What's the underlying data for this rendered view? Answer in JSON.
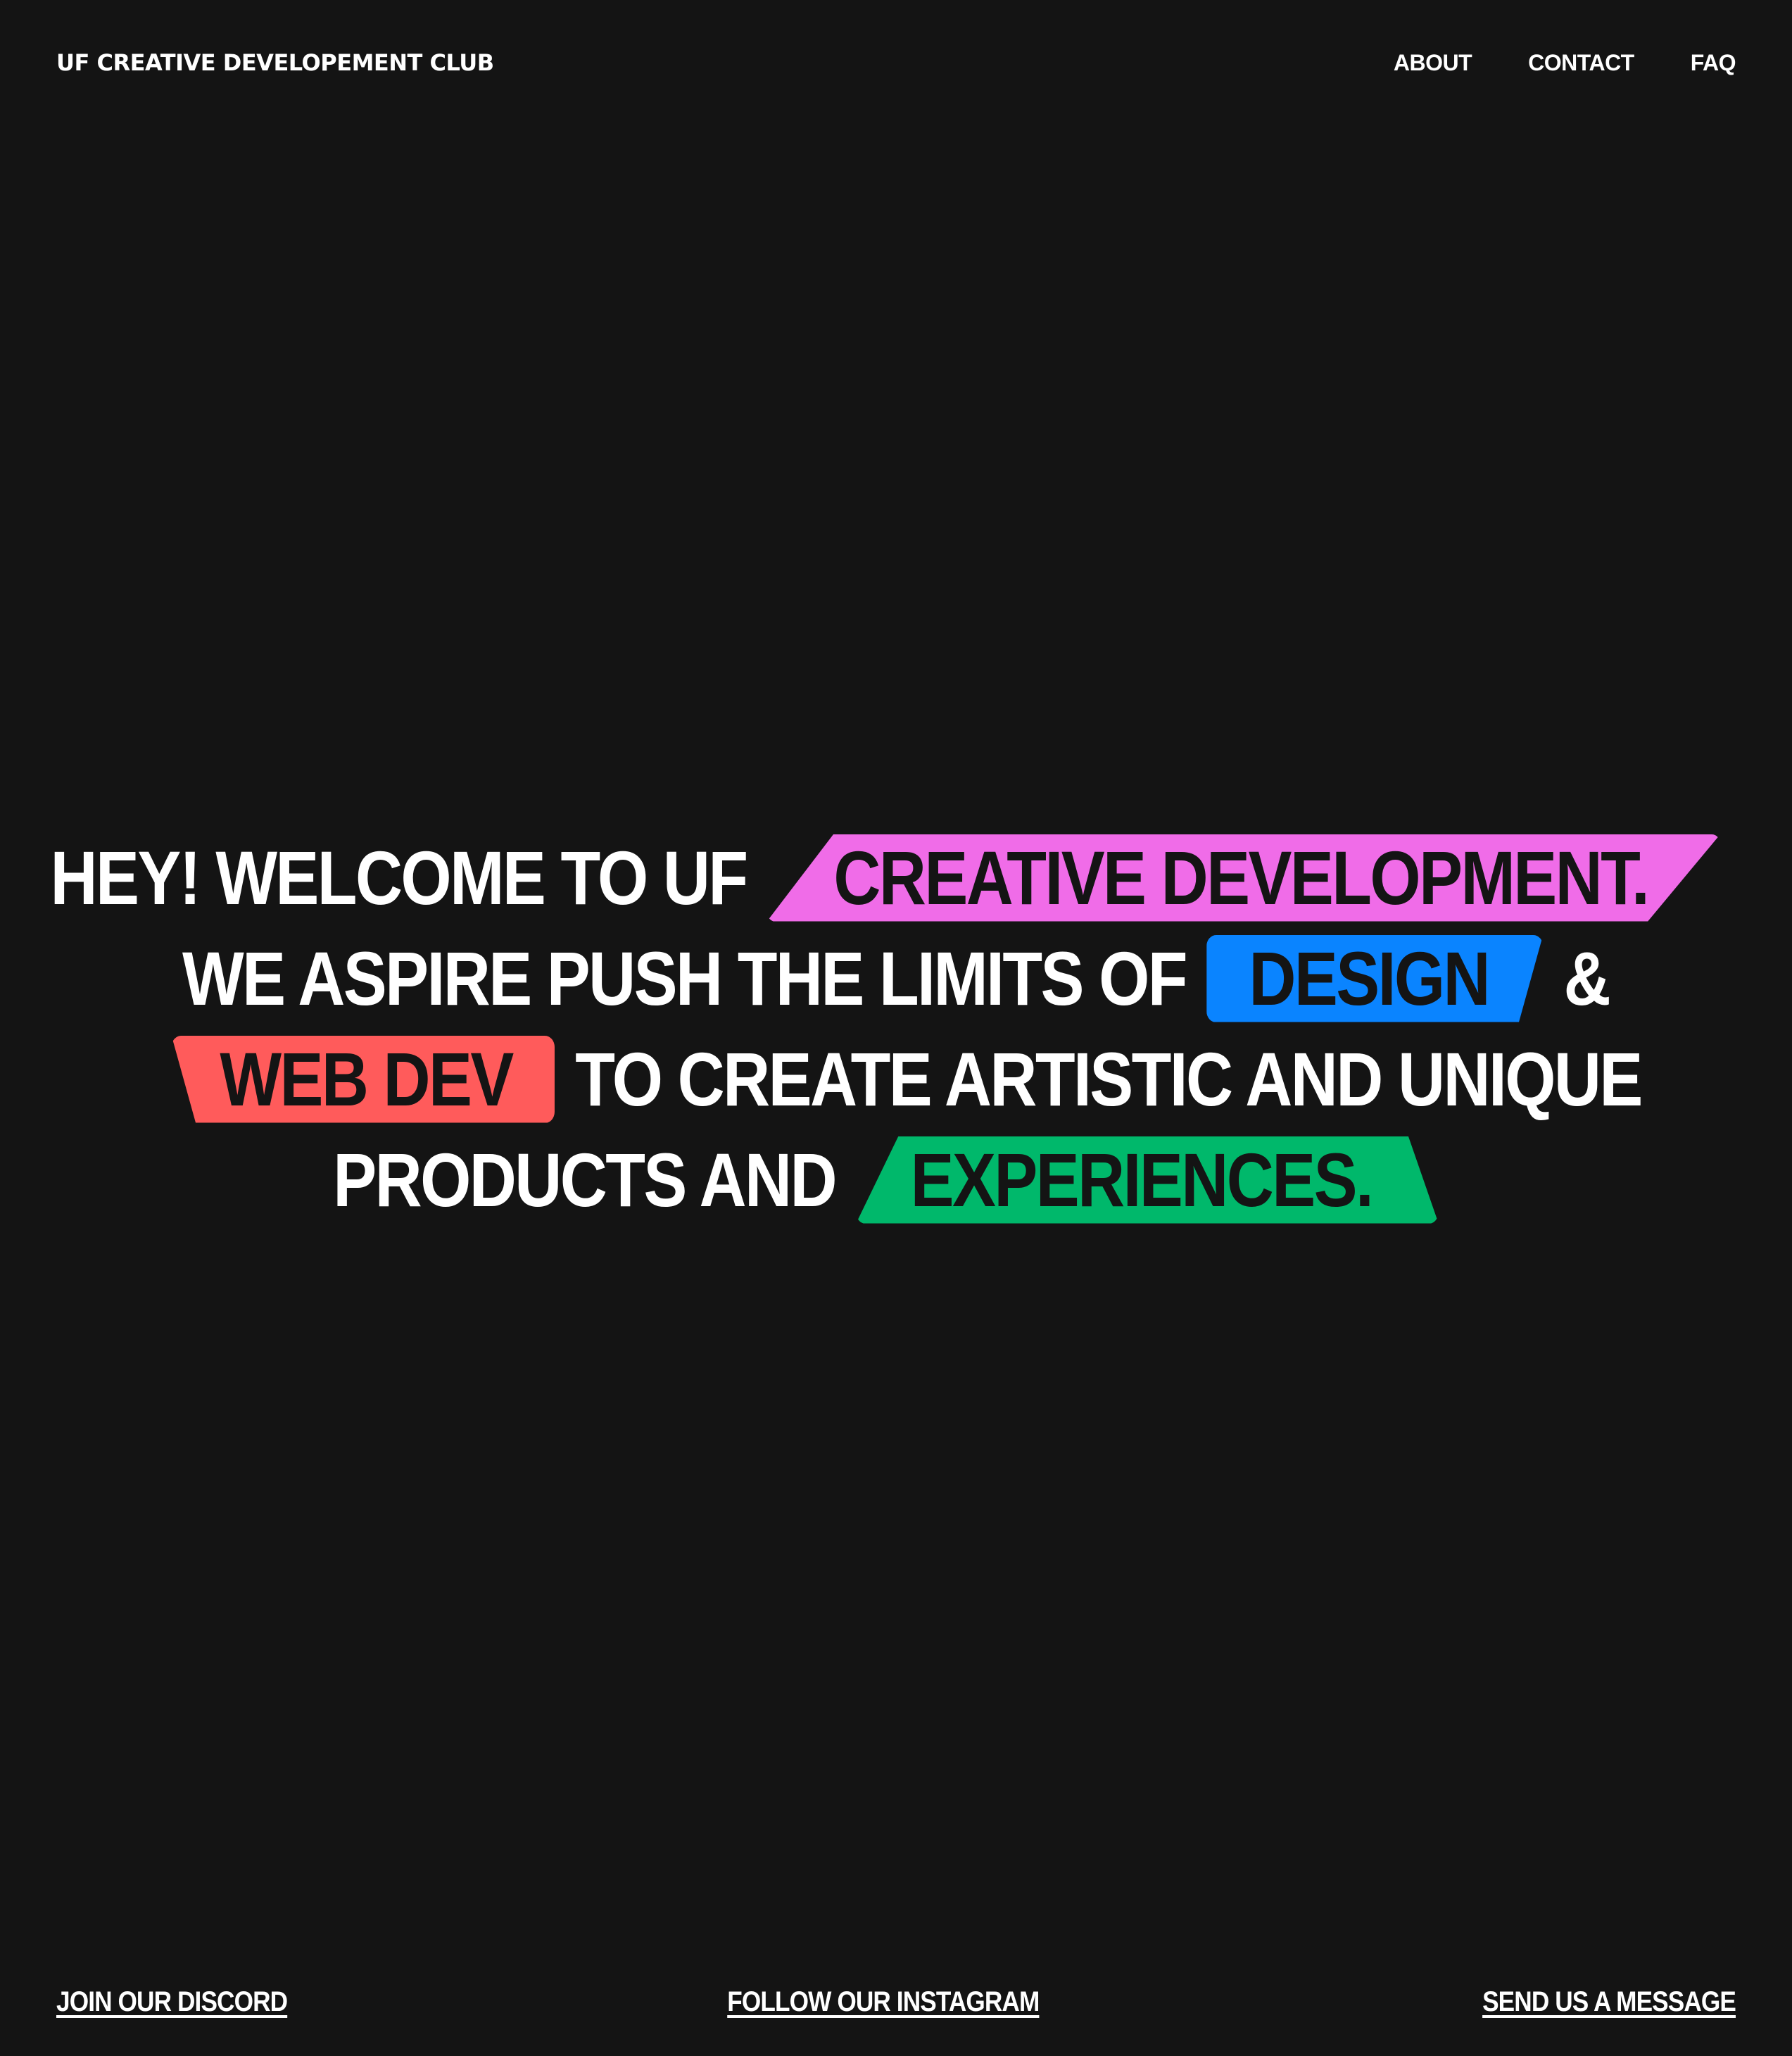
{
  "header": {
    "logo": "UF CREATIVE DEVELOPEMENT CLUB",
    "nav": [
      {
        "label": "ABOUT"
      },
      {
        "label": "CONTACT"
      },
      {
        "label": "FAQ"
      }
    ]
  },
  "hero": {
    "line1": {
      "text": "HEY! WELCOME TO UF",
      "tag": "CREATIVE DEVELOPMENT."
    },
    "line2": {
      "text": "WE ASPIRE PUSH THE LIMITS OF",
      "tag": "DESIGN",
      "suffix": "&"
    },
    "line3": {
      "tag": "WEB DEV",
      "text": "TO CREATE ARTISTIC AND UNIQUE"
    },
    "line4": {
      "text": "PRODUCTS AND",
      "tag": "EXPERIENCES."
    }
  },
  "footer": {
    "discord": "JOIN OUR DISCORD",
    "instagram": "FOLLOW OUR INSTAGRAM",
    "message": "SEND US A MESSAGE"
  },
  "colors": {
    "background": "#141414",
    "text": "#ffffff",
    "pink": "#f06ce8",
    "blue": "#0a84ff",
    "red": "#ff5b5b",
    "green": "#00b86b"
  }
}
